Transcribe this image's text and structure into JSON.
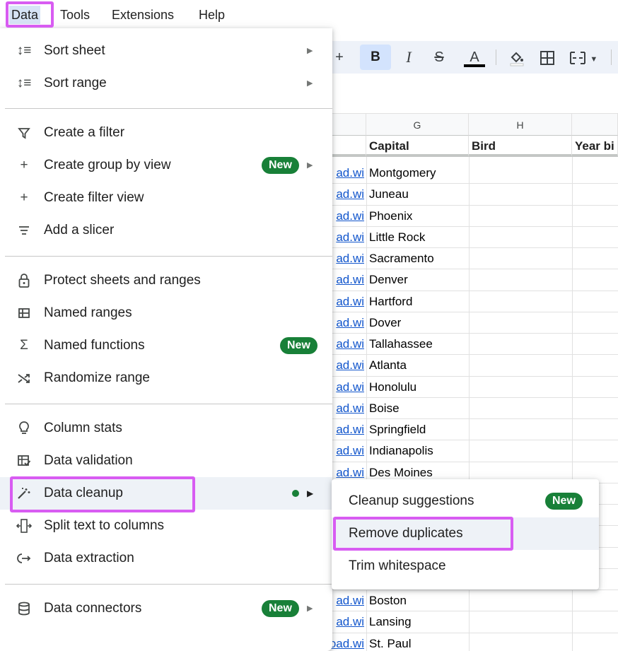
{
  "menubar": {
    "items": [
      "Data",
      "Tools",
      "Extensions",
      "Help"
    ]
  },
  "toolbar": {
    "plus": "+",
    "bold": "B",
    "italic": "I",
    "strike": "S",
    "text_color": "A"
  },
  "grid": {
    "columns": [
      "G",
      "H"
    ],
    "headers": [
      "Capital",
      "Bird",
      "Year bi"
    ],
    "link_text": "ad.wi",
    "last_link_text": "https://upload.wi",
    "capitals": [
      "Montgomery",
      "Juneau",
      "Phoenix",
      "Little Rock",
      "Sacramento",
      "Denver",
      "Hartford",
      "Dover",
      "Tallahassee",
      "Atlanta",
      "Honolulu",
      "Boise",
      "Springfield",
      "Indianapolis",
      "Des Moines",
      "",
      "",
      "",
      "",
      "",
      "Boston",
      "Lansing",
      "St. Paul"
    ]
  },
  "data_menu": {
    "items": [
      {
        "icon": "sort-icon",
        "label": "Sort sheet"
      },
      {
        "icon": "sort-icon",
        "label": "Sort range"
      },
      {
        "icon": "filter-icon",
        "label": "Create a filter"
      },
      {
        "icon": "plus-icon",
        "label": "Create group by view",
        "badge": "New"
      },
      {
        "icon": "plus-icon",
        "label": "Create filter view"
      },
      {
        "icon": "slicer-icon",
        "label": "Add a slicer"
      },
      {
        "icon": "lock-icon",
        "label": "Protect sheets and ranges"
      },
      {
        "icon": "named-ranges-icon",
        "label": "Named ranges"
      },
      {
        "icon": "sigma-icon",
        "label": "Named functions",
        "badge": "New"
      },
      {
        "icon": "shuffle-icon",
        "label": "Randomize range"
      },
      {
        "icon": "lightbulb-icon",
        "label": "Column stats"
      },
      {
        "icon": "validation-icon",
        "label": "Data validation"
      },
      {
        "icon": "magic-wand-icon",
        "label": "Data cleanup"
      },
      {
        "icon": "split-icon",
        "label": "Split text to columns"
      },
      {
        "icon": "extraction-icon",
        "label": "Data extraction"
      },
      {
        "icon": "database-icon",
        "label": "Data connectors",
        "badge": "New"
      }
    ]
  },
  "submenu": {
    "items": [
      {
        "label": "Cleanup suggestions",
        "badge": "New"
      },
      {
        "label": "Remove duplicates"
      },
      {
        "label": "Trim whitespace"
      }
    ]
  },
  "colors": {
    "highlight": "#d85cf2",
    "badge_green": "#188038",
    "link_blue": "#1155cc"
  }
}
